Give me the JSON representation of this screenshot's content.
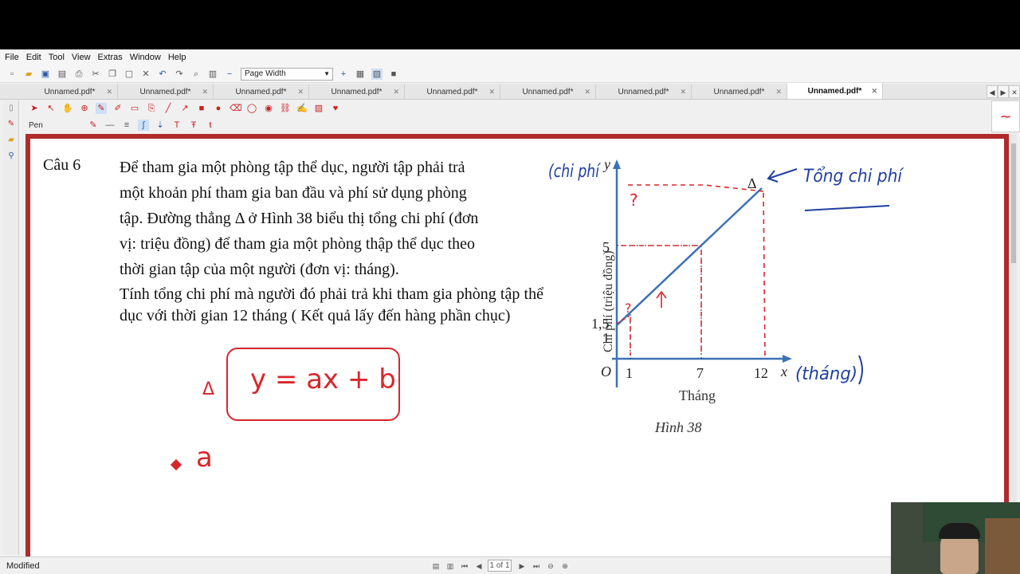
{
  "menu": {
    "file": "File",
    "edit": "Edit",
    "tool": "Tool",
    "view": "View",
    "extras": "Extras",
    "window": "Window",
    "help": "Help"
  },
  "toolbar": {
    "zoom_mode": "Page Width"
  },
  "tabs": [
    "Unnamed.pdf*",
    "Unnamed.pdf*",
    "Unnamed.pdf*",
    "Unnamed.pdf*",
    "Unnamed.pdf*",
    "Unnamed.pdf*",
    "Unnamed.pdf*",
    "Unnamed.pdf*",
    "Unnamed.pdf*",
    "Unnamed.pdf*"
  ],
  "tool_label": "Pen",
  "status": {
    "label": "Modified",
    "page_indicator": "1 of 1"
  },
  "question": {
    "label": "Câu 6",
    "lines": [
      "Để tham gia một phòng tập  thể dục, người tập phải trả",
      "một khoản phí tham gia ban đầu và phí sử dụng phòng",
      "tập. Đường thẳng Δ ở Hình 38 biểu thị tổng chi phí (đơn",
      "vị: triệu đồng) để tham gia một phòng thập thể dục theo",
      "thời gian tập của một người (đơn vị: tháng)."
    ],
    "task": "Tính tổng chi phí mà người đó phải trả khi tham gia phòng tập thể dục với thời gian 12 tháng ( Kết quả lấy đến hàng phần chục)"
  },
  "figure": {
    "caption": "Hình 38",
    "xlabel": "Tháng",
    "ylabel": "Chi phí (triệu đồng)",
    "x_axis": "x",
    "y_axis": "y",
    "origin": "O",
    "line_label": "Δ",
    "x_ticks": [
      "1",
      "7",
      "12"
    ],
    "y_ticks": [
      "1,5",
      "1",
      "5"
    ]
  },
  "annotations": {
    "equation": "y = ax + b",
    "delta": "Δ",
    "a_note": "a",
    "total_cost": "Tổng chi phí",
    "cost_note": "(chi phí",
    "month_note": "(tháng)",
    "q1": "?",
    "q2": "?"
  },
  "colors": {
    "annotation_red": "#d8262c",
    "annotation_blue": "#1f3fa0",
    "graph_blue": "#3d72b5",
    "frame": "#b02a2a"
  }
}
